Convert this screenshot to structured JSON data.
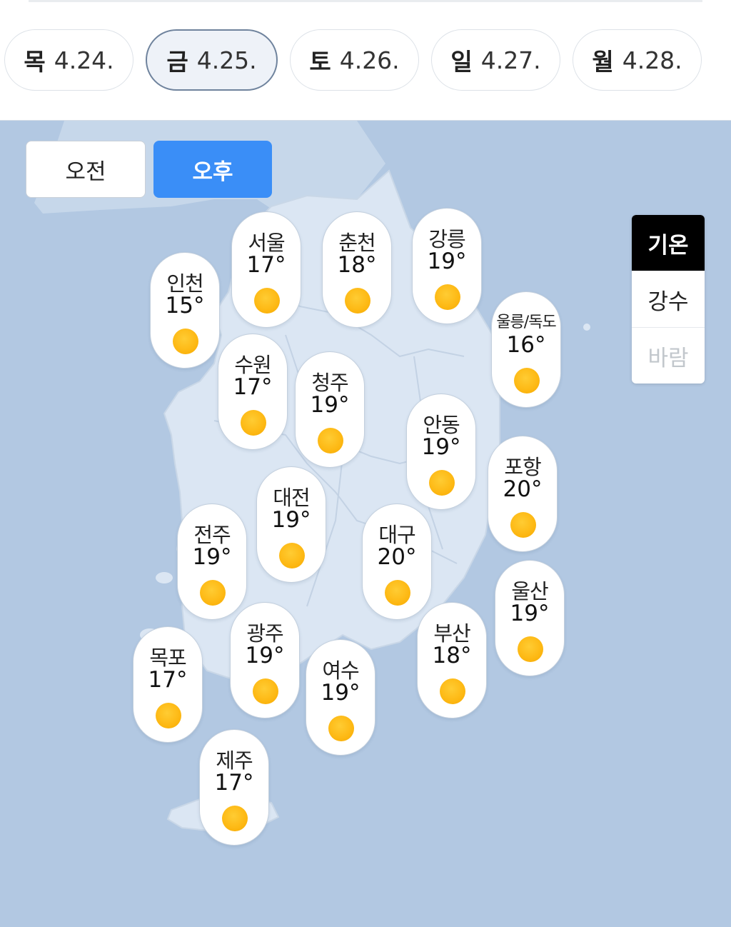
{
  "dates": [
    {
      "dow": "목",
      "date": "4.24.",
      "active": false
    },
    {
      "dow": "금",
      "date": "4.25.",
      "active": true
    },
    {
      "dow": "토",
      "date": "4.26.",
      "active": false
    },
    {
      "dow": "일",
      "date": "4.27.",
      "active": false
    },
    {
      "dow": "월",
      "date": "4.28.",
      "active": false
    }
  ],
  "time_toggle": {
    "am": "오전",
    "pm": "오후",
    "selected": "pm"
  },
  "type_selector": {
    "items": [
      "기온",
      "강수",
      "바람"
    ],
    "selected": "기온",
    "disabled": [
      "바람"
    ]
  },
  "cities": [
    {
      "name": "서울",
      "temp": "17°",
      "icon": "sun-icon"
    },
    {
      "name": "춘천",
      "temp": "18°",
      "icon": "sun-icon"
    },
    {
      "name": "강릉",
      "temp": "19°",
      "icon": "sun-icon"
    },
    {
      "name": "인천",
      "temp": "15°",
      "icon": "sun-icon"
    },
    {
      "name": "울릉/독도",
      "temp": "16°",
      "icon": "sun-icon"
    },
    {
      "name": "수원",
      "temp": "17°",
      "icon": "sun-icon"
    },
    {
      "name": "청주",
      "temp": "19°",
      "icon": "sun-icon"
    },
    {
      "name": "안동",
      "temp": "19°",
      "icon": "sun-icon"
    },
    {
      "name": "포항",
      "temp": "20°",
      "icon": "sun-icon"
    },
    {
      "name": "대전",
      "temp": "19°",
      "icon": "sun-icon"
    },
    {
      "name": "전주",
      "temp": "19°",
      "icon": "sun-icon"
    },
    {
      "name": "대구",
      "temp": "20°",
      "icon": "sun-icon"
    },
    {
      "name": "울산",
      "temp": "19°",
      "icon": "sun-icon"
    },
    {
      "name": "광주",
      "temp": "19°",
      "icon": "sun-icon"
    },
    {
      "name": "부산",
      "temp": "18°",
      "icon": "sun-icon"
    },
    {
      "name": "목포",
      "temp": "17°",
      "icon": "sun-icon"
    },
    {
      "name": "여수",
      "temp": "19°",
      "icon": "sun-icon"
    },
    {
      "name": "제주",
      "temp": "17°",
      "icon": "sun-icon"
    }
  ],
  "colors": {
    "sea": "#b2c8e2",
    "land": "#dbe6f3",
    "accent_blue": "#3a8ef7",
    "sun": "#fdb813"
  }
}
